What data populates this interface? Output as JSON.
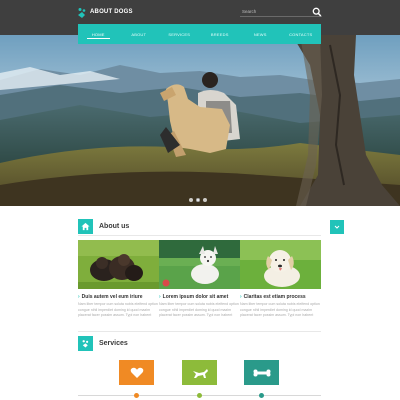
{
  "brand": {
    "name": "ABOUT DOGS",
    "accent": "#21c3b9"
  },
  "search": {
    "placeholder": "Search"
  },
  "nav": {
    "items": [
      {
        "label": "HOME",
        "active": true
      },
      {
        "label": "ABOUT"
      },
      {
        "label": "SERVICES"
      },
      {
        "label": "BREEDS"
      },
      {
        "label": "NEWS"
      },
      {
        "label": "CONTACTS"
      }
    ]
  },
  "slider": {
    "slides": 3,
    "active_index": 1
  },
  "about": {
    "title": "About us",
    "cards": [
      {
        "caption": "Duis autem vel eum iriure",
        "text": "Nam liber tempor cum soluta nobis eleifend option congue nihil imperdiet doming id quod mazim placerat facer possim assum. Typi non habent"
      },
      {
        "caption": "Lorem ipsum dolor sit amet",
        "text": "Nam liber tempor cum soluta nobis eleifend option congue nihil imperdiet doming id quod mazim placerat facer possim assum. Typi non habent"
      },
      {
        "caption": "Claritas est etiam process",
        "text": "Nam liber tempor cum soluta nobis eleifend option congue nihil imperdiet doming id quod mazim placerat facer possim assum. Typi non habent"
      }
    ]
  },
  "services": {
    "title": "Services",
    "items": [
      {
        "icon": "heart-icon",
        "color": "#f08a24"
      },
      {
        "icon": "running-dog-icon",
        "color": "#8dbb3a"
      },
      {
        "icon": "bone-icon",
        "color": "#2a9a8a"
      }
    ]
  }
}
